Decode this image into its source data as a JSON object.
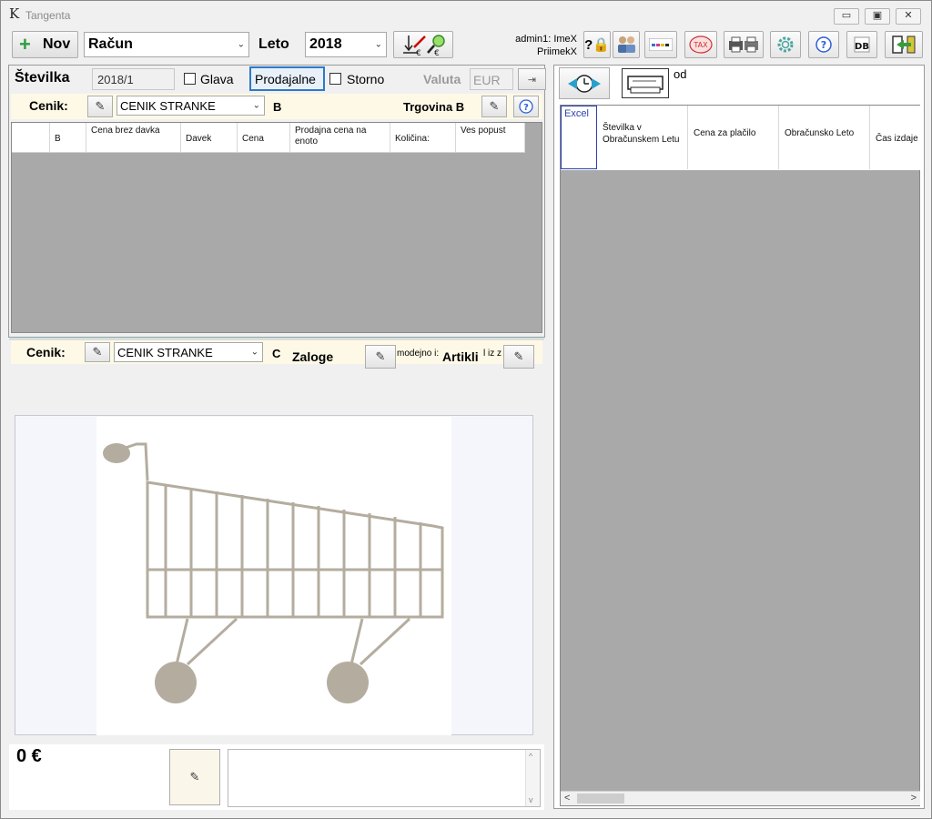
{
  "window": {
    "title": "Tangenta",
    "app_icon": "tangenta-k-logo",
    "caption_minimize": "▭",
    "caption_restore": "▣",
    "caption_close": "✕"
  },
  "toolbar": {
    "new_label": "Nov",
    "doc_type": "Račun",
    "year_label": "Leto",
    "year_value": "2018",
    "user_line1": "admin1: ImeX",
    "user_line2": "PriimekX"
  },
  "header_row": {
    "number_label": "Številka",
    "number_value": "2018/1",
    "glava_label": "Glava",
    "prodajalne_label": "Prodajalne",
    "storno_label": "Storno",
    "valuta_label": "Valuta",
    "valuta_value": "EUR"
  },
  "upper_cenik": {
    "label": "Cenik:",
    "value": "CENIK STRANKE",
    "suffix": "B",
    "trgovina_label": "Trgovina B"
  },
  "items_table": {
    "columns": [
      "B",
      "Cena brez davka",
      "Davek",
      "Cena",
      "Prodajna cena na enoto",
      "Količina:",
      "Ves popust"
    ]
  },
  "lower_cenik": {
    "label": "Cenik:",
    "value": "CENIK STRANKE",
    "suffix": "C",
    "zaloge_label": "Zaloge",
    "modejno_label": "modejno i:",
    "artikli_label": "Artikli",
    "iz_label": "l iz z"
  },
  "footer": {
    "total": "0 €"
  },
  "right_panel": {
    "od_label": "od",
    "excel_label": "Excel",
    "columns": [
      "Številka v Obračunskem Letu",
      "Cena za plačilo",
      "Obračunsko Leto",
      "Čas izdaje"
    ]
  },
  "colors": {
    "grid_gray": "#a9a9a9",
    "strip_yellow": "#fdf9e6",
    "accent_blue": "#1a5fb4",
    "plus_green": "#2e9e3e"
  }
}
